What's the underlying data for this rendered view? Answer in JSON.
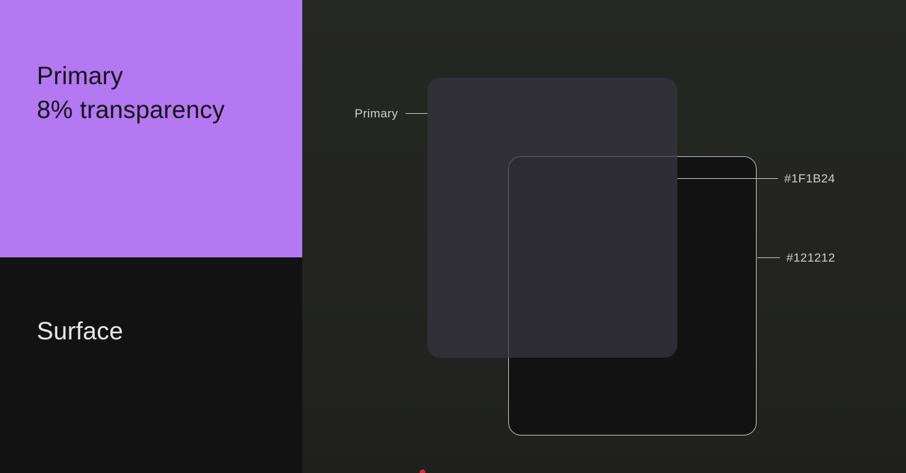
{
  "swatches": {
    "primary": {
      "line1": "Primary",
      "line2": "8% transparency",
      "color": "#B378F2"
    },
    "surface": {
      "label": "Surface",
      "color": "#121212"
    }
  },
  "diagram": {
    "primary_label": "Primary",
    "overlay_hex": "#1F1B24",
    "surface_hex": "#121212"
  }
}
